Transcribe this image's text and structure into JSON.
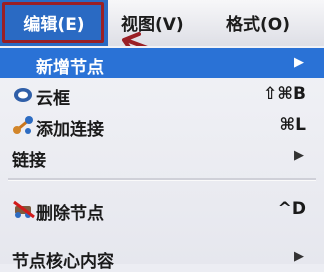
{
  "menubar": {
    "edit": "编辑(E)",
    "view": "视图(V)",
    "format": "格式(O)"
  },
  "menu": {
    "items": [
      {
        "label": "新增节点",
        "shortcut": "",
        "submenu": true
      },
      {
        "label": "云框",
        "shortcut": "⇧⌘B",
        "submenu": false
      },
      {
        "label": "添加连接",
        "shortcut": "⌘L",
        "submenu": false
      },
      {
        "label": "链接",
        "shortcut": "",
        "submenu": true
      },
      {
        "label": "删除节点",
        "shortcut": "^D",
        "submenu": false
      },
      {
        "label": "节点核心内容",
        "shortcut": "",
        "submenu": true
      }
    ],
    "submenu_glyph": "▶"
  },
  "colors": {
    "selection": "#2a72d6",
    "annotation": "#9a1f25"
  },
  "icons": [
    "cloud-icon",
    "add-connection-icon",
    "delete-node-icon"
  ]
}
